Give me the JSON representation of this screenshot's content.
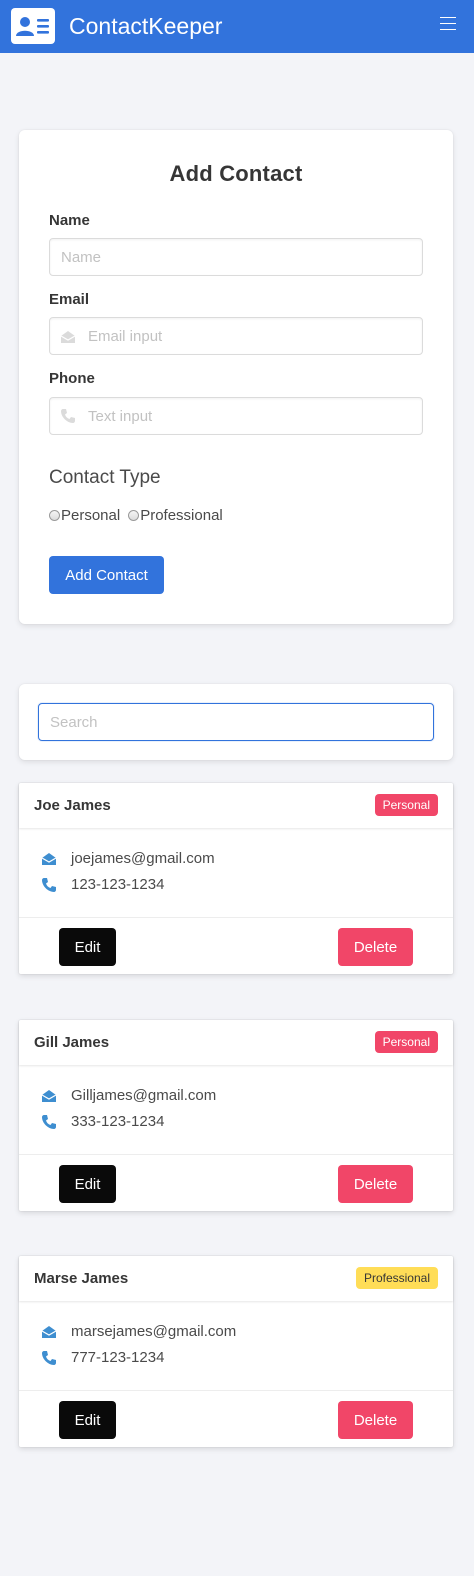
{
  "app": {
    "title": "ContactKeeper"
  },
  "colors": {
    "brand": "#3273dc",
    "danger": "#f14668",
    "warning": "#ffdd57",
    "dark": "#0a0a0a",
    "icon_accent": "#3e8ed0",
    "background": "#f3f4f8"
  },
  "navbar": {
    "logo_icon": "contact-card-icon",
    "menu_icon": "hamburger-icon"
  },
  "form": {
    "title": "Add Contact",
    "name": {
      "label": "Name",
      "placeholder": "Name",
      "value": ""
    },
    "email": {
      "label": "Email",
      "placeholder": "Email input",
      "value": "",
      "icon": "envelope-open-icon"
    },
    "phone": {
      "label": "Phone",
      "placeholder": "Text input",
      "value": "",
      "icon": "phone-icon"
    },
    "contact_type": {
      "title": "Contact Type",
      "options": [
        "Personal",
        "Professional"
      ],
      "selected": null
    },
    "submit_label": "Add Contact"
  },
  "search": {
    "placeholder": "Search",
    "value": ""
  },
  "contacts": [
    {
      "name": "Joe James",
      "type": "Personal",
      "email": "joejames@gmail.com",
      "phone": "123-123-1234",
      "edit_label": "Edit",
      "delete_label": "Delete"
    },
    {
      "name": "Gill James",
      "type": "Personal",
      "email": "Gilljames@gmail.com",
      "phone": "333-123-1234",
      "edit_label": "Edit",
      "delete_label": "Delete"
    },
    {
      "name": "Marse James",
      "type": "Professional",
      "email": "marsejames@gmail.com",
      "phone": "777-123-1234",
      "edit_label": "Edit",
      "delete_label": "Delete"
    }
  ]
}
